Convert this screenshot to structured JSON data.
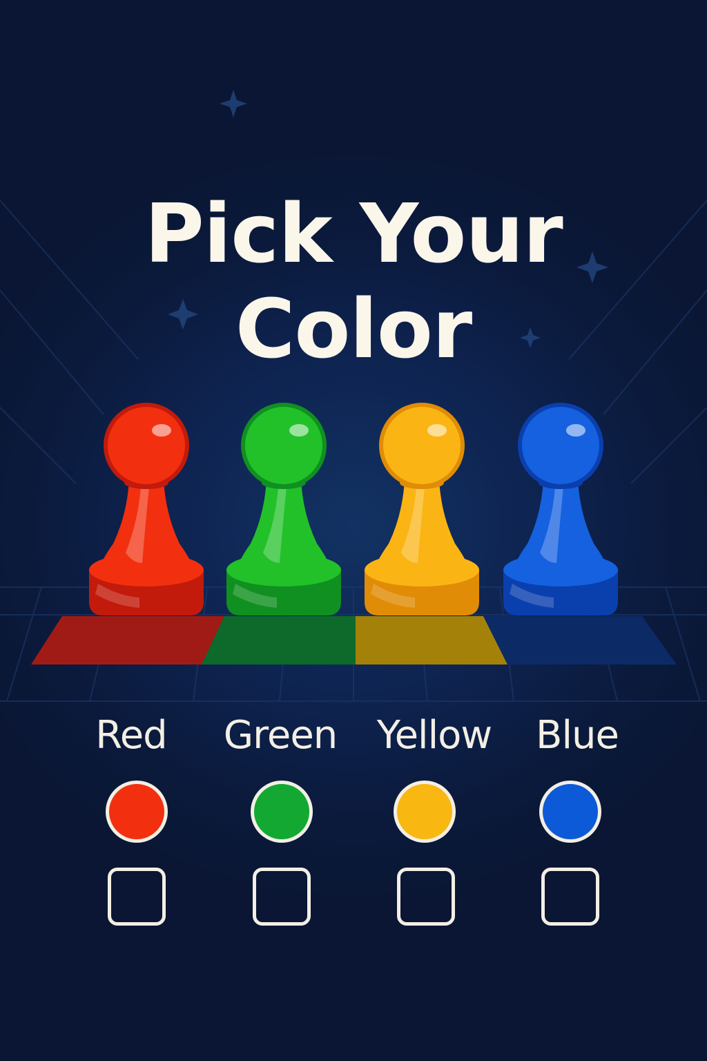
{
  "title": {
    "line1": "Pick Your",
    "line2": "Color"
  },
  "colors": [
    {
      "label": "Red",
      "hex": "#f2300f",
      "checked": false
    },
    {
      "label": "Green",
      "hex": "#12a832",
      "checked": false
    },
    {
      "label": "Yellow",
      "hex": "#f9b711",
      "checked": false
    },
    {
      "label": "Blue",
      "hex": "#0c5ad8",
      "checked": false
    }
  ],
  "icons": [
    "red-pawn-icon",
    "green-pawn-icon",
    "yellow-pawn-icon",
    "blue-pawn-icon",
    "sparkle-icon"
  ],
  "background": "#0b1733",
  "text_color": "#f3efe4"
}
